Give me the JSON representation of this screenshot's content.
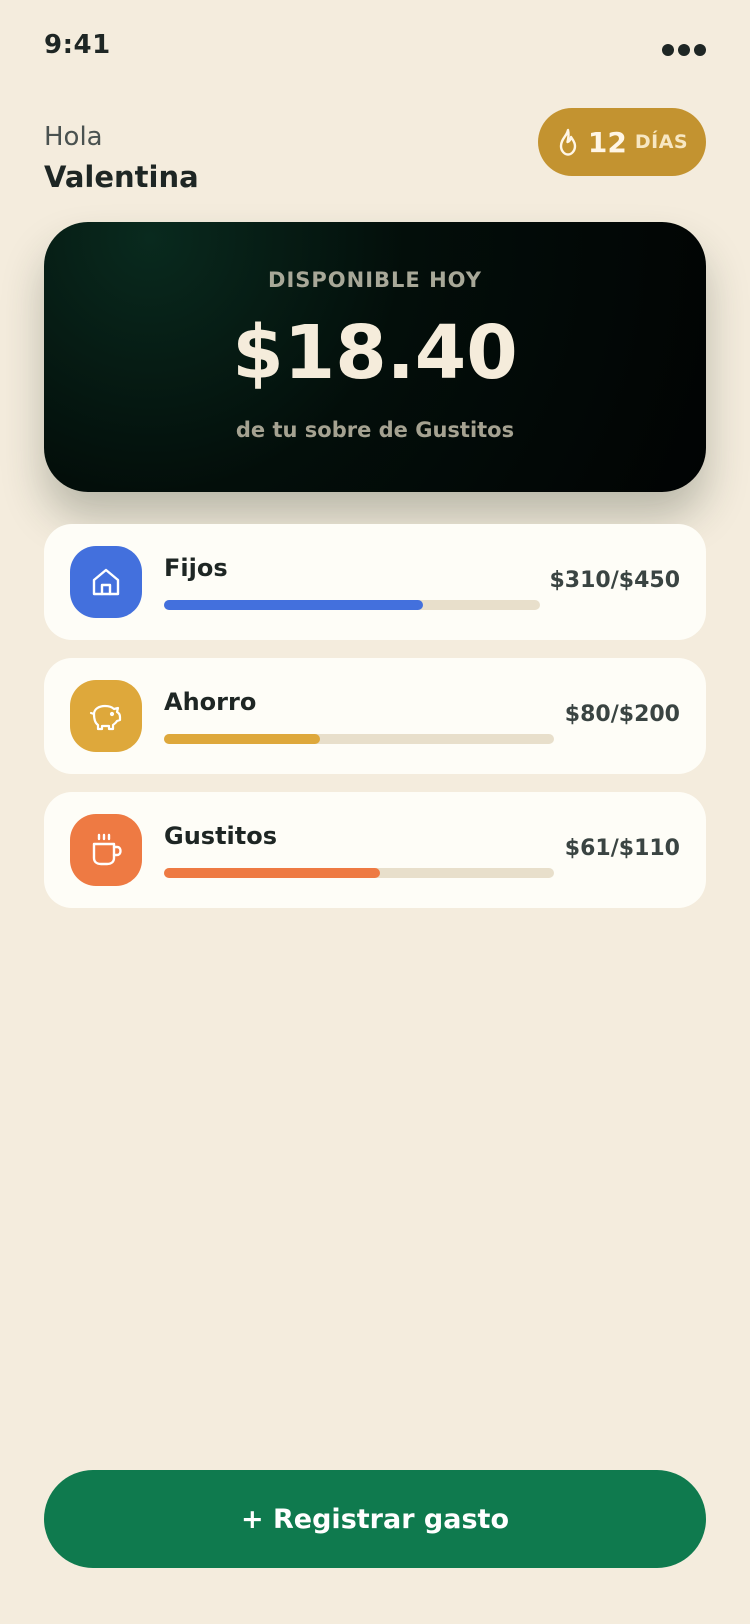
{
  "status_bar": {
    "time": "9:41",
    "menu_icon": "more-dots-icon"
  },
  "header": {
    "greeting": "Hola",
    "user_name": "Valentina",
    "streak": {
      "icon": "flame-icon",
      "count": "12",
      "unit": "DÍAS",
      "color": "#C39330"
    }
  },
  "balance_card": {
    "label": "DISPONIBLE HOY",
    "amount": "$18.40",
    "subtitle": "de tu sobre de Gustitos"
  },
  "envelopes": [
    {
      "name": "Fijos",
      "amount_label": "$310/$450",
      "spent": 310,
      "budget": 450,
      "icon": "house-icon",
      "color": "#4370DD"
    },
    {
      "name": "Ahorro",
      "amount_label": "$80/$200",
      "spent": 80,
      "budget": 200,
      "icon": "piggy-bank-icon",
      "color": "#DEA83B"
    },
    {
      "name": "Gustitos",
      "amount_label": "$61/$110",
      "spent": 61,
      "budget": 110,
      "icon": "coffee-cup-icon",
      "color": "#EE7A43"
    }
  ],
  "primary_action": {
    "label": "+ Registrar gasto",
    "color": "#0F7A4E"
  }
}
